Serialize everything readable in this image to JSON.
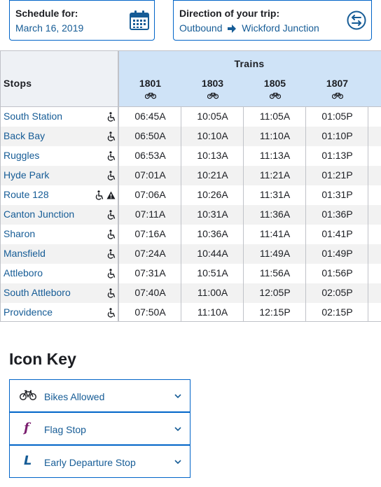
{
  "schedule_selector": {
    "label": "Schedule for:",
    "value": "March 16, 2019",
    "icon": "calendar-icon"
  },
  "direction_selector": {
    "label": "Direction of your trip:",
    "direction": "Outbound",
    "destination": "Wickford Junction",
    "icon": "swap-direction-icon"
  },
  "table": {
    "stops_header": "Stops",
    "trains_header": "Trains",
    "trains": [
      "1801",
      "1803",
      "1805",
      "1807"
    ],
    "rows": [
      {
        "stop": "South Station",
        "times": [
          "06:45A",
          "10:05A",
          "11:05A",
          "01:05P"
        ],
        "alert": false
      },
      {
        "stop": "Back Bay",
        "times": [
          "06:50A",
          "10:10A",
          "11:10A",
          "01:10P"
        ],
        "alert": false
      },
      {
        "stop": "Ruggles",
        "times": [
          "06:53A",
          "10:13A",
          "11:13A",
          "01:13P"
        ],
        "alert": false
      },
      {
        "stop": "Hyde Park",
        "times": [
          "07:01A",
          "10:21A",
          "11:21A",
          "01:21P"
        ],
        "alert": false
      },
      {
        "stop": "Route 128",
        "times": [
          "07:06A",
          "10:26A",
          "11:31A",
          "01:31P"
        ],
        "alert": true
      },
      {
        "stop": "Canton Junction",
        "times": [
          "07:11A",
          "10:31A",
          "11:36A",
          "01:36P"
        ],
        "alert": false
      },
      {
        "stop": "Sharon",
        "times": [
          "07:16A",
          "10:36A",
          "11:41A",
          "01:41P"
        ],
        "alert": false
      },
      {
        "stop": "Mansfield",
        "times": [
          "07:24A",
          "10:44A",
          "11:49A",
          "01:49P"
        ],
        "alert": false
      },
      {
        "stop": "Attleboro",
        "times": [
          "07:31A",
          "10:51A",
          "11:56A",
          "01:56P"
        ],
        "alert": false
      },
      {
        "stop": "South Attleboro",
        "times": [
          "07:40A",
          "11:00A",
          "12:05P",
          "02:05P"
        ],
        "alert": false
      },
      {
        "stop": "Providence",
        "times": [
          "07:50A",
          "11:10A",
          "12:15P",
          "02:15P"
        ],
        "alert": false
      }
    ]
  },
  "icon_key": {
    "title": "Icon Key",
    "items": [
      {
        "label": "Bikes Allowed",
        "icon": "bike-icon"
      },
      {
        "label": "Flag Stop",
        "symbol": "f",
        "icon": "flag-stop-icon"
      },
      {
        "label": "Early Departure Stop",
        "symbol": "L",
        "icon": "early-departure-icon"
      }
    ]
  },
  "colors": {
    "link": "#165c96",
    "border": "#0064c8",
    "trains_header_bg": "#cfe3f7",
    "flag_stop": "#7a1d6e"
  }
}
